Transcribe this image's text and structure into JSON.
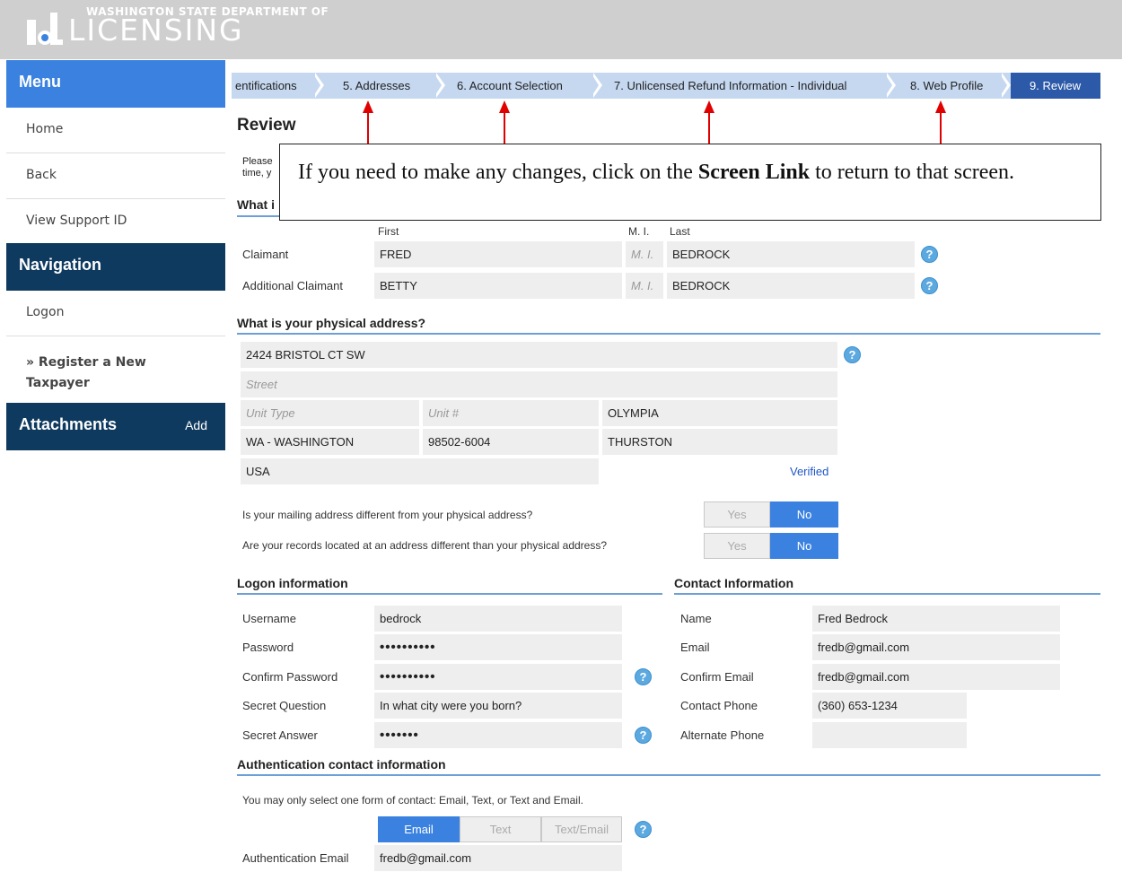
{
  "header": {
    "agency_top": "WASHINGTON STATE DEPARTMENT OF",
    "agency_name": "LICENSING"
  },
  "sidebar": {
    "menu_title": "Menu",
    "menu_items": [
      "Home",
      "Back",
      "View Support ID"
    ],
    "navigation_title": "Navigation",
    "nav_items": [
      "Logon",
      "» Register a New Taxpayer"
    ],
    "attachments_title": "Attachments",
    "attachments_add": "Add"
  },
  "breadcrumb": {
    "items": [
      "entifications",
      "5. Addresses",
      "6. Account Selection",
      "7. Unlicensed Refund Information - Individual",
      "8. Web Profile",
      "9. Review"
    ]
  },
  "page_title": "Review",
  "callout": {
    "text_before": "If you need to make any changes, click on the ",
    "text_bold": "Screen Link",
    "text_after": " to return to that screen."
  },
  "intro": {
    "line1": "Please",
    "line2": "time, y",
    "section_partial": "What i"
  },
  "claimants": {
    "col_first": "First",
    "col_mi": "M. I.",
    "col_last": "Last",
    "rows": [
      {
        "label": "Claimant",
        "first": "FRED",
        "mi_placeholder": "M. I.",
        "last": "BEDROCK"
      },
      {
        "label": "Additional Claimant",
        "first": "BETTY",
        "mi_placeholder": "M. I.",
        "last": "BEDROCK"
      }
    ]
  },
  "physical_address": {
    "title": "What is your physical address?",
    "street1": "2424 BRISTOL CT SW",
    "street2_placeholder": "Street",
    "unit_type_placeholder": "Unit Type",
    "unit_no_placeholder": "Unit #",
    "city": "OLYMPIA",
    "state": "WA - WASHINGTON",
    "zip": "98502-6004",
    "county": "THURSTON",
    "country": "USA",
    "verified": "Verified"
  },
  "questions": {
    "mailing": "Is your mailing address different from your physical address?",
    "records": "Are your records located at an address different than your physical address?",
    "yes": "Yes",
    "no": "No"
  },
  "logon": {
    "title": "Logon information",
    "username_label": "Username",
    "username": "bedrock",
    "password_label": "Password",
    "password": "••••••••••",
    "confirm_label": "Confirm Password",
    "confirm": "••••••••••",
    "secret_q_label": "Secret Question",
    "secret_q": "In what city were you born?",
    "secret_a_label": "Secret Answer",
    "secret_a": "•••••••"
  },
  "contact": {
    "title": "Contact Information",
    "name_label": "Name",
    "name": "Fred Bedrock",
    "email_label": "Email",
    "email": "fredb@gmail.com",
    "confirm_email_label": "Confirm Email",
    "confirm_email": "fredb@gmail.com",
    "phone_label": "Contact Phone",
    "phone": "(360) 653-1234",
    "alt_phone_label": "Alternate Phone",
    "alt_phone": ""
  },
  "auth": {
    "title": "Authentication contact information",
    "note": "You may only select one form of contact: Email, Text, or Text and Email.",
    "options": [
      "Email",
      "Text",
      "Text/Email"
    ],
    "email_label": "Authentication Email",
    "email": "fredb@gmail.com"
  },
  "colors": {
    "menu_blue": "#3b82e0",
    "nav_dark": "#0f3a5f",
    "rule_blue": "#6e9fd6",
    "crumb_light": "#c5d8f0",
    "crumb_active": "#2d5aa8",
    "arrow_red": "#e00000"
  }
}
